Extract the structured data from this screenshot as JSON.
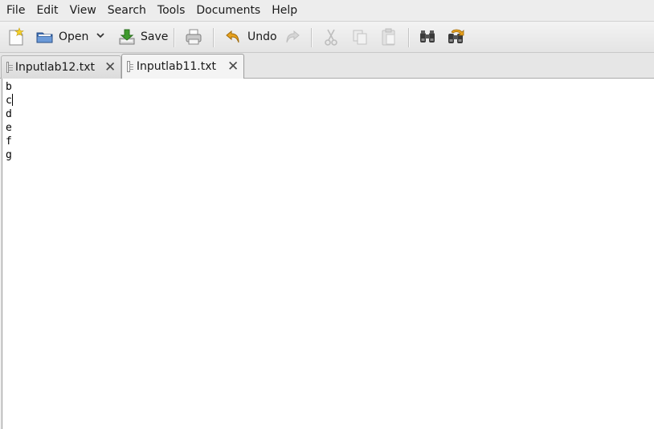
{
  "menubar": {
    "items": [
      "File",
      "Edit",
      "View",
      "Search",
      "Tools",
      "Documents",
      "Help"
    ]
  },
  "toolbar": {
    "new_icon": "new-document-icon",
    "open_label": "Open",
    "open_icon": "folder-open-icon",
    "open_dropdown_icon": "chevron-down-icon",
    "save_label": "Save",
    "save_icon": "save-icon",
    "print_icon": "print-icon",
    "undo_label": "Undo",
    "undo_icon": "undo-icon",
    "redo_icon": "redo-icon",
    "cut_icon": "cut-icon",
    "copy_icon": "copy-icon",
    "paste_icon": "paste-icon",
    "find_icon": "binoculars-icon",
    "replace_icon": "find-replace-icon"
  },
  "tabs": [
    {
      "label": "Inputlab12.txt",
      "active": false
    },
    {
      "label": "Inputlab11.txt",
      "active": true
    }
  ],
  "editor": {
    "lines": [
      "b",
      "c",
      "d",
      "e",
      "f",
      "g"
    ],
    "caret_line": 2,
    "caret_after_text": true
  },
  "colors": {
    "window_bg": "#ededed",
    "editor_bg": "#ffffff",
    "undo_accent": "#e2a11e",
    "save_accent": "#3f9b2e",
    "open_accent": "#3e6fb4"
  }
}
